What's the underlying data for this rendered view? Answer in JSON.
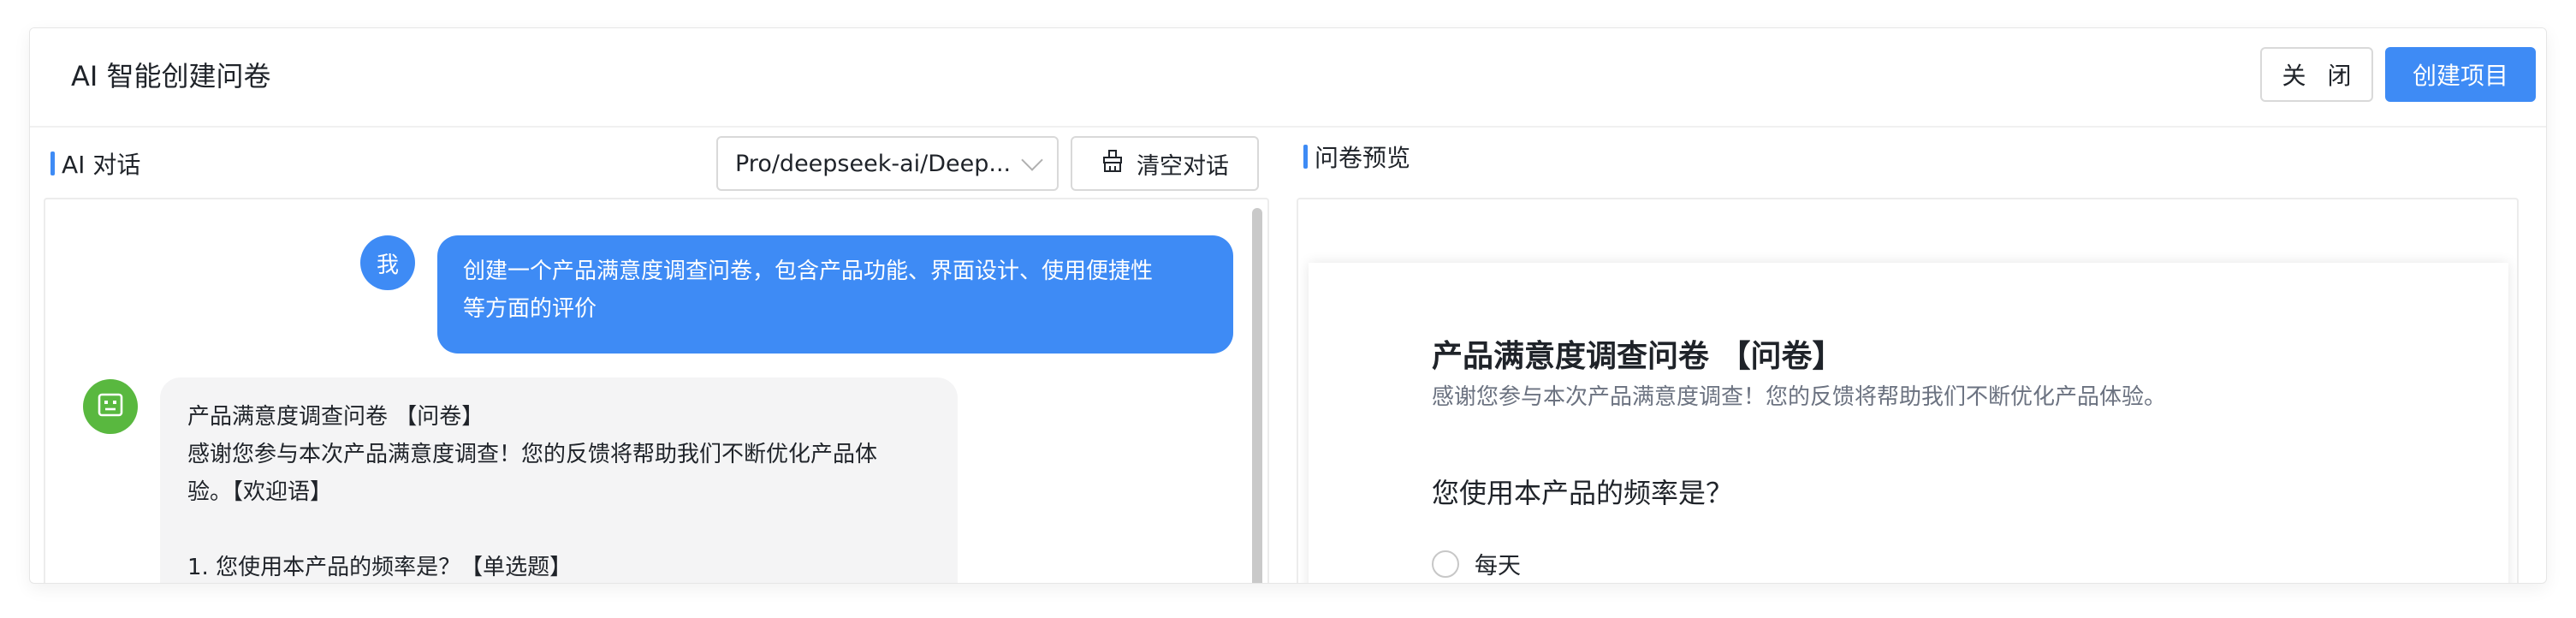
{
  "header": {
    "title": "AI 智能创建问卷",
    "close_label": "关 闭",
    "create_label": "创建项目"
  },
  "left": {
    "label": "AI 对话",
    "model_select": {
      "value": "Pro/deepseek-ai/Deep..."
    },
    "clear_label": "清空对话",
    "messages": {
      "user": {
        "avatar_text": "我",
        "lines": [
          "创建一个产品满意度调查问卷，包含产品功能、界面设计、使用便捷性",
          "等方面的评价"
        ]
      },
      "ai": {
        "lines": [
          "产品满意度调查问卷 【问卷】",
          "感谢您参与本次产品满意度调查！您的反馈将帮助我们不断优化产品体",
          "验。【欢迎语】",
          "",
          "1. 您使用本产品的频率是？【单选题】"
        ]
      }
    }
  },
  "right": {
    "label": "问卷预览",
    "survey": {
      "title": "产品满意度调查问卷 【问卷】",
      "description": "感谢您参与本次产品满意度调查！您的反馈将帮助我们不断优化产品体验。",
      "question": "您使用本产品的频率是？",
      "options": [
        "每天"
      ]
    }
  },
  "colors": {
    "primary": "#3e8bf5",
    "ai_avatar": "#59b83f",
    "ai_bubble": "#f4f4f5"
  },
  "icons": {
    "clear": "broom-icon",
    "ai_avatar": "robot-icon",
    "select_arrow": "chevron-down-icon"
  }
}
